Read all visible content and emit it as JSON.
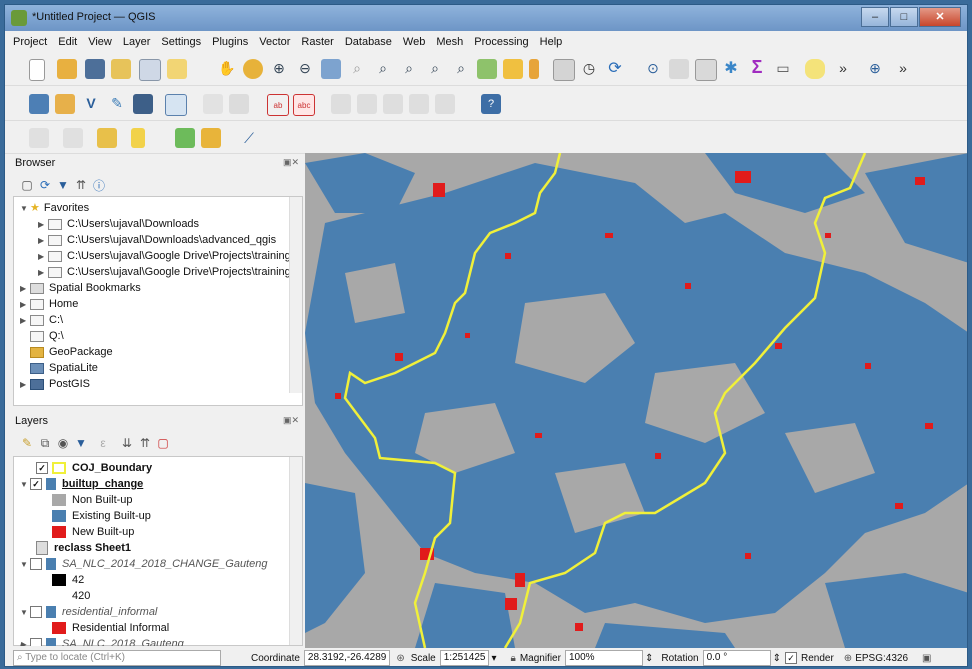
{
  "window": {
    "title": "*Untitled Project — QGIS",
    "min": "–",
    "max": "□",
    "close": "✕"
  },
  "menu": [
    "Project",
    "Edit",
    "View",
    "Layer",
    "Settings",
    "Plugins",
    "Vector",
    "Raster",
    "Database",
    "Web",
    "Mesh",
    "Processing",
    "Help"
  ],
  "browser": {
    "title": "Browser",
    "items": [
      {
        "label": "Favorites"
      },
      {
        "label": "C:\\Users\\ujaval\\Downloads"
      },
      {
        "label": "C:\\Users\\ujaval\\Downloads\\advanced_qgis"
      },
      {
        "label": "C:\\Users\\ujaval\\Google Drive\\Projects\\training"
      },
      {
        "label": "C:\\Users\\ujaval\\Google Drive\\Projects\\training"
      },
      {
        "label": "Spatial Bookmarks"
      },
      {
        "label": "Home"
      },
      {
        "label": "C:\\"
      },
      {
        "label": "Q:\\"
      },
      {
        "label": "GeoPackage"
      },
      {
        "label": "SpatiaLite"
      },
      {
        "label": "PostGIS"
      }
    ]
  },
  "layers": {
    "title": "Layers",
    "items": [
      {
        "label": "COJ_Boundary",
        "checked": true
      },
      {
        "label": "builtup_change",
        "checked": true
      },
      {
        "label": "Non Built-up",
        "color": "#a8a8a8"
      },
      {
        "label": "Existing Built-up",
        "color": "#4a7fb0"
      },
      {
        "label": "New Built-up",
        "color": "#e11b1b"
      },
      {
        "label": "reclass Sheet1"
      },
      {
        "label": "SA_NLC_2014_2018_CHANGE_Gauteng",
        "checked": false
      },
      {
        "label": "42",
        "color": "#000000"
      },
      {
        "label": "420"
      },
      {
        "label": "residential_informal",
        "checked": false
      },
      {
        "label": "Residential Informal",
        "color": "#e11b1b"
      },
      {
        "label": "SA_NLC_2018_Gauteng",
        "checked": false
      }
    ]
  },
  "status": {
    "locate_placeholder": "Type to locate (Ctrl+K)",
    "coordinate_label": "Coordinate",
    "coordinate_value": "28.3192,-26.4289",
    "scale_label": "Scale",
    "scale_value": "1:251425",
    "magnifier_label": "Magnifier",
    "magnifier_value": "100%",
    "rotation_label": "Rotation",
    "rotation_value": "0.0 °",
    "render_label": "Render",
    "crs": "EPSG:4326"
  },
  "colors": {
    "boundary": "#f0f03a",
    "builtup": "#4a7fb0",
    "new": "#e11b1b",
    "nonbuilt": "#a8a8a8"
  }
}
